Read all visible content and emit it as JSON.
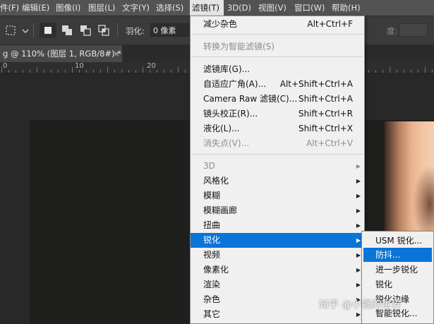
{
  "menubar": {
    "items": [
      {
        "label": "件(F)"
      },
      {
        "label": "编辑(E)"
      },
      {
        "label": "图像(I)"
      },
      {
        "label": "图层(L)"
      },
      {
        "label": "文字(Y)"
      },
      {
        "label": "选择(S)"
      },
      {
        "label": "滤镜(T)"
      },
      {
        "label": "3D(D)"
      },
      {
        "label": "视图(V)"
      },
      {
        "label": "窗口(W)"
      },
      {
        "label": "帮助(H)"
      }
    ]
  },
  "options_bar": {
    "feather_label": "羽化:",
    "feather_value": "0 像素",
    "right_label": "度:"
  },
  "document_tab": {
    "title": "g @ 110% (图层 1, RGB/8#) *",
    "close": "×"
  },
  "ruler": {
    "numbers": [
      "0",
      "10",
      "20"
    ]
  },
  "filter_menu": {
    "reduce_noise": {
      "label": "减少杂色",
      "shortcut": "Alt+Ctrl+F"
    },
    "convert_smart": {
      "label": "转换为智能滤镜(S)"
    },
    "filter_gallery": {
      "label": "滤镜库(G)..."
    },
    "adaptive_wide": {
      "label": "自适应广角(A)...",
      "shortcut": "Alt+Shift+Ctrl+A"
    },
    "camera_raw": {
      "label": "Camera Raw 滤镜(C)...",
      "shortcut": "Shift+Ctrl+A"
    },
    "lens_correction": {
      "label": "镜头校正(R)...",
      "shortcut": "Shift+Ctrl+R"
    },
    "liquify": {
      "label": "液化(L)...",
      "shortcut": "Shift+Ctrl+X"
    },
    "vanishing_point": {
      "label": "消失点(V)...",
      "shortcut": "Alt+Ctrl+V"
    },
    "submenus": [
      {
        "label": "3D"
      },
      {
        "label": "风格化"
      },
      {
        "label": "模糊"
      },
      {
        "label": "模糊画廊"
      },
      {
        "label": "扭曲"
      },
      {
        "label": "锐化"
      },
      {
        "label": "视频"
      },
      {
        "label": "像素化"
      },
      {
        "label": "渲染"
      },
      {
        "label": "杂色"
      },
      {
        "label": "其它"
      }
    ]
  },
  "sharpen_submenu": {
    "items": [
      {
        "label": "USM 锐化..."
      },
      {
        "label": "防抖..."
      },
      {
        "label": "进一步锐化"
      },
      {
        "label": "锐化"
      },
      {
        "label": "锐化边缘"
      },
      {
        "label": "智能锐化..."
      }
    ]
  },
  "watermark": {
    "text": "知乎 @小强的世界"
  },
  "colors": {
    "menu_highlight": "#0b74d8",
    "menubar_bg": "#535353",
    "menu_bg": "#f0f0f0"
  }
}
